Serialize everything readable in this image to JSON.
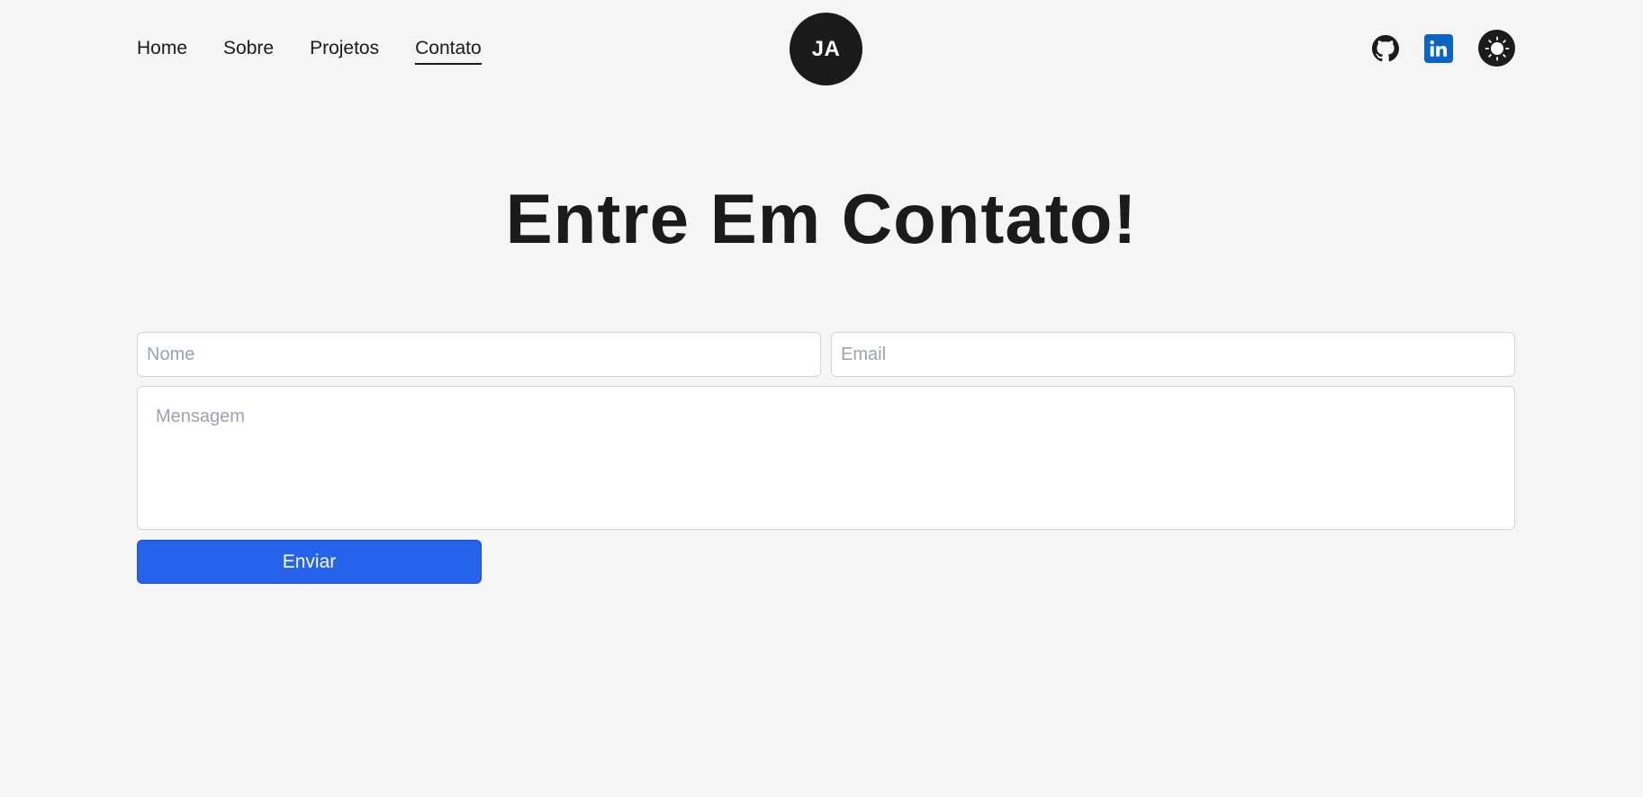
{
  "nav": {
    "links": [
      {
        "label": "Home"
      },
      {
        "label": "Sobre"
      },
      {
        "label": "Projetos"
      },
      {
        "label": "Contato",
        "active": true
      }
    ],
    "logo_text": "JA",
    "icons": [
      "github-icon",
      "linkedin-icon",
      "sun-icon"
    ]
  },
  "main": {
    "title": "Entre Em Contato!"
  },
  "form": {
    "name_placeholder": "Nome",
    "email_placeholder": "Email",
    "message_placeholder": "Mensagem",
    "submit_label": "Enviar"
  },
  "colors": {
    "background": "#f5f5f5",
    "text": "#1b1b1b",
    "accent": "#2563eb",
    "linkedin": "#0a66c2"
  }
}
